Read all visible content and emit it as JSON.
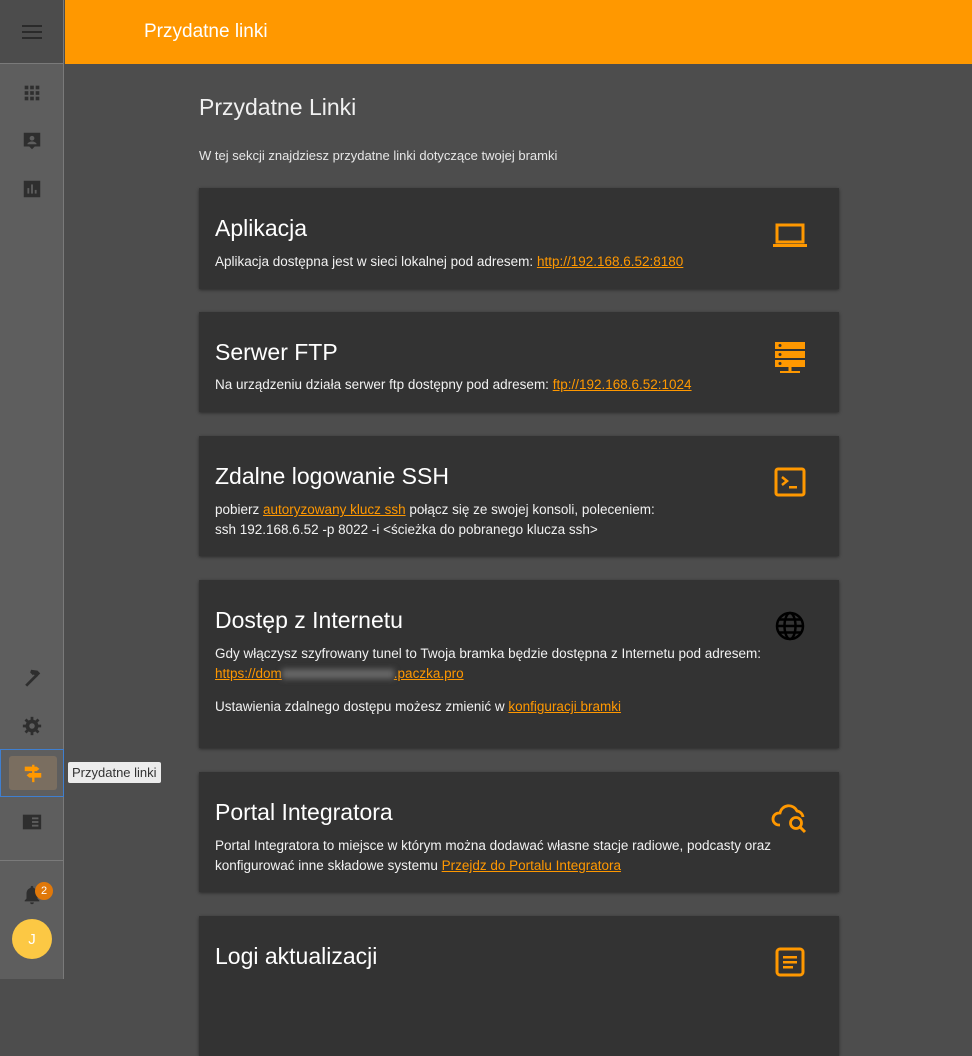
{
  "topbar": {
    "title": "Przydatne linki"
  },
  "tooltip": "Przydatne linki",
  "notifications": {
    "count": "2"
  },
  "user": {
    "initial": "J"
  },
  "page": {
    "title": "Przydatne Linki",
    "description": "W tej sekcji znajdziesz przydatne linki dotyczące twojej bramki"
  },
  "cards": {
    "app": {
      "title": "Aplikacja",
      "text": "Aplikacja dostępna jest w sieci lokalnej pod adresem: ",
      "link": "http://192.168.6.52:8180",
      "icon": "laptop-icon"
    },
    "ftp": {
      "title": "Serwer FTP",
      "text": "Na urządzeniu działa serwer ftp dostępny pod adresem: ",
      "link": "ftp://192.168.6.52:1024",
      "icon": "server-icon"
    },
    "ssh": {
      "title": "Zdalne logowanie SSH",
      "text_before": "pobierz ",
      "link": "autoryzowany klucz ssh",
      "text_after": " połącz się ze swojej konsoli, poleceniem:",
      "command": "ssh 192.168.6.52 -p 8022 -i <ścieżka do pobranego klucza ssh>",
      "icon": "terminal-icon"
    },
    "internet": {
      "title": "Dostęp z Internetu",
      "text": "Gdy włączysz szyfrowany tunel to Twoja bramka będzie dostępna z Internetu pod adresem:",
      "link_start": "https://dom",
      "link_end": ".paczka.pro",
      "settings_text": "Ustawienia zdalnego dostępu możesz zmienić w ",
      "settings_link": "konfiguracji bramki",
      "icon": "globe-icon"
    },
    "portal": {
      "title": "Portal Integratora",
      "text_line1": "Portal Integratora to miejsce w którym można dodawać własne stacje radiowe, podcasty oraz",
      "text_line2": "konfigurować inne składowe systemu ",
      "link": "Przejdz do Portalu Integratora",
      "icon": "cloud-search-icon"
    },
    "logs": {
      "title": "Logi aktualizacji",
      "icon": "article-icon"
    }
  },
  "colors": {
    "accent": "#ff9800",
    "card_bg": "#333333",
    "page_bg": "#4d4d4d",
    "sidebar_bg": "#5e5e5e"
  }
}
